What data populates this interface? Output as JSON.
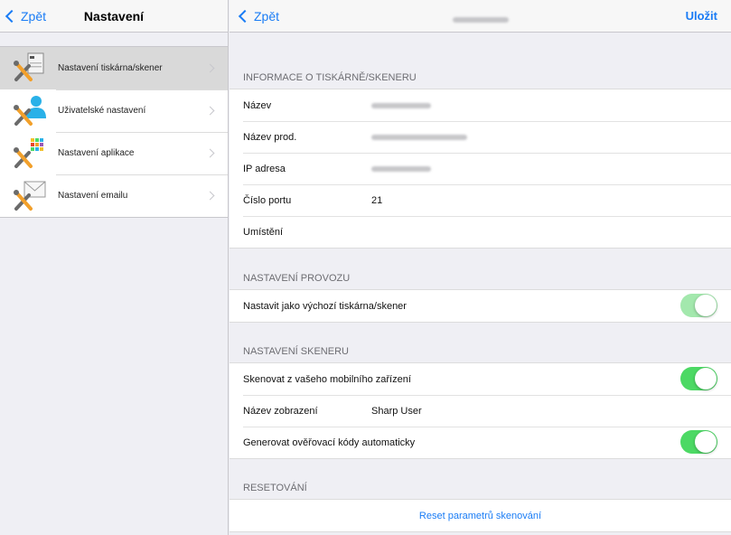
{
  "left": {
    "back_label": "Zpět",
    "title": "Nastavení",
    "items": [
      {
        "label": "Nastavení tiskárna/skener",
        "icon": "printer-settings-icon",
        "selected": true
      },
      {
        "label": "Uživatelské nastavení",
        "icon": "user-settings-icon",
        "selected": false
      },
      {
        "label": "Nastavení aplikace",
        "icon": "app-settings-icon",
        "selected": false
      },
      {
        "label": "Nastavení emailu",
        "icon": "email-settings-icon",
        "selected": false
      }
    ]
  },
  "right": {
    "back_label": "Zpět",
    "save_label": "Uložit",
    "info_header": "INFORMACE O TISKÁRNĚ/SKENERU",
    "info_rows": [
      {
        "label": "Název"
      },
      {
        "label": "Název prod."
      },
      {
        "label": "IP adresa"
      },
      {
        "label": "Číslo portu",
        "value": "21"
      },
      {
        "label": "Umístění",
        "value": ""
      }
    ],
    "operation_header": "NASTAVENÍ PROVOZU",
    "operation_default_label": "Nastavit jako výchozí tiskárna/skener",
    "operation_default_on": true,
    "scanner_header": "NASTAVENÍ SKENERU",
    "scan_mobile_label": "Skenovat z vašeho mobilního zařízení",
    "scan_mobile_on": true,
    "display_name_label": "Název zobrazení",
    "display_name_value": "Sharp User",
    "gen_codes_label": "Generovat ověřovací kódy automaticky",
    "gen_codes_on": true,
    "reset_header": "RESETOVÁNÍ",
    "reset_label": "Reset parametrů skenování"
  },
  "colors": {
    "accent": "#1a7cf5",
    "toggle_on": "#4cd964",
    "selected_bg": "#d9d9d9"
  }
}
